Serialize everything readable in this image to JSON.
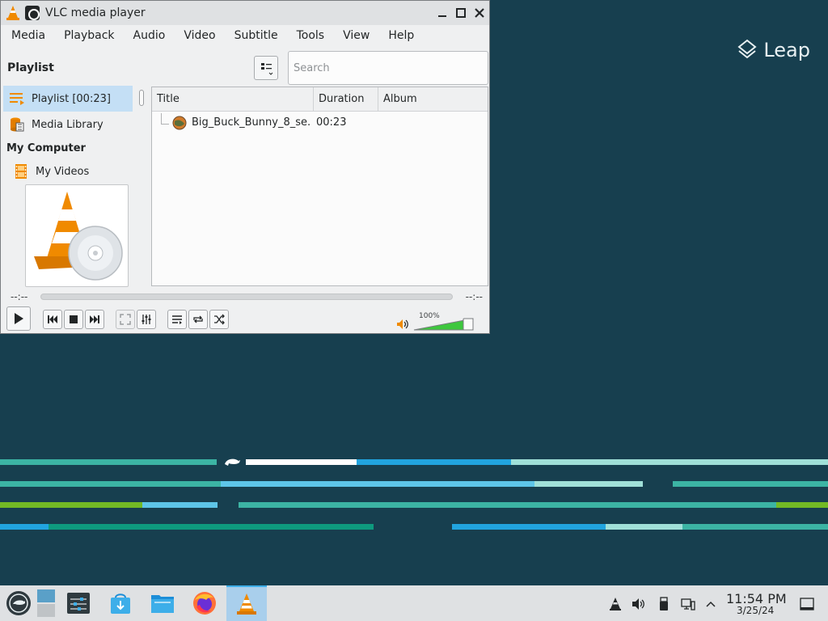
{
  "desktop": {
    "logo_text": "Leap",
    "stripe_colors": [
      "#3cb4a4",
      "#ffffff",
      "#21a4df",
      "#a0e0d8",
      "#5ec5e8",
      "#73ba25",
      "#0e9a7e"
    ]
  },
  "window": {
    "title": "VLC media player",
    "controls": [
      "minimize-icon",
      "maximize-icon",
      "close-icon"
    ]
  },
  "menubar": {
    "items": [
      "Media",
      "Playback",
      "Audio",
      "Video",
      "Subtitle",
      "Tools",
      "View",
      "Help"
    ]
  },
  "playlist": {
    "heading": "Playlist",
    "search_placeholder": "Search"
  },
  "sidebar": {
    "items": [
      {
        "label": "Playlist [00:23]",
        "icon": "playlist-icon",
        "selected": true
      },
      {
        "label": "Media Library",
        "icon": "media-library-icon",
        "selected": false
      }
    ],
    "section": "My Computer",
    "computer_items": [
      {
        "label": "My Videos",
        "icon": "film-icon"
      }
    ]
  },
  "table": {
    "columns": [
      "Title",
      "Duration",
      "Album"
    ],
    "rows": [
      {
        "title": "Big_Buck_Bunny_8_se...",
        "duration": "00:23",
        "album": ""
      }
    ]
  },
  "player": {
    "elapsed": "--:--",
    "total": "--:--",
    "volume_label": "100%",
    "volume_level": 1.0
  },
  "taskbar": {
    "apps": [
      "opensuse-launcher-icon",
      "pager-icon",
      "system-settings-icon",
      "discover-store-icon",
      "file-manager-icon",
      "firefox-icon",
      "vlc-icon"
    ],
    "active_app": "vlc-icon",
    "tray": [
      "vlc-tray-icon",
      "volume-tray-icon",
      "usb-device-icon",
      "network-icon",
      "show-hidden-icon"
    ],
    "clock_time": "11:54 PM",
    "clock_date": "3/25/24"
  },
  "colors": {
    "desktop_bg": "#173f4f",
    "selection": "#c4dff5",
    "vlc_orange": "#f08a00",
    "volume_green": "#3ec73e"
  }
}
